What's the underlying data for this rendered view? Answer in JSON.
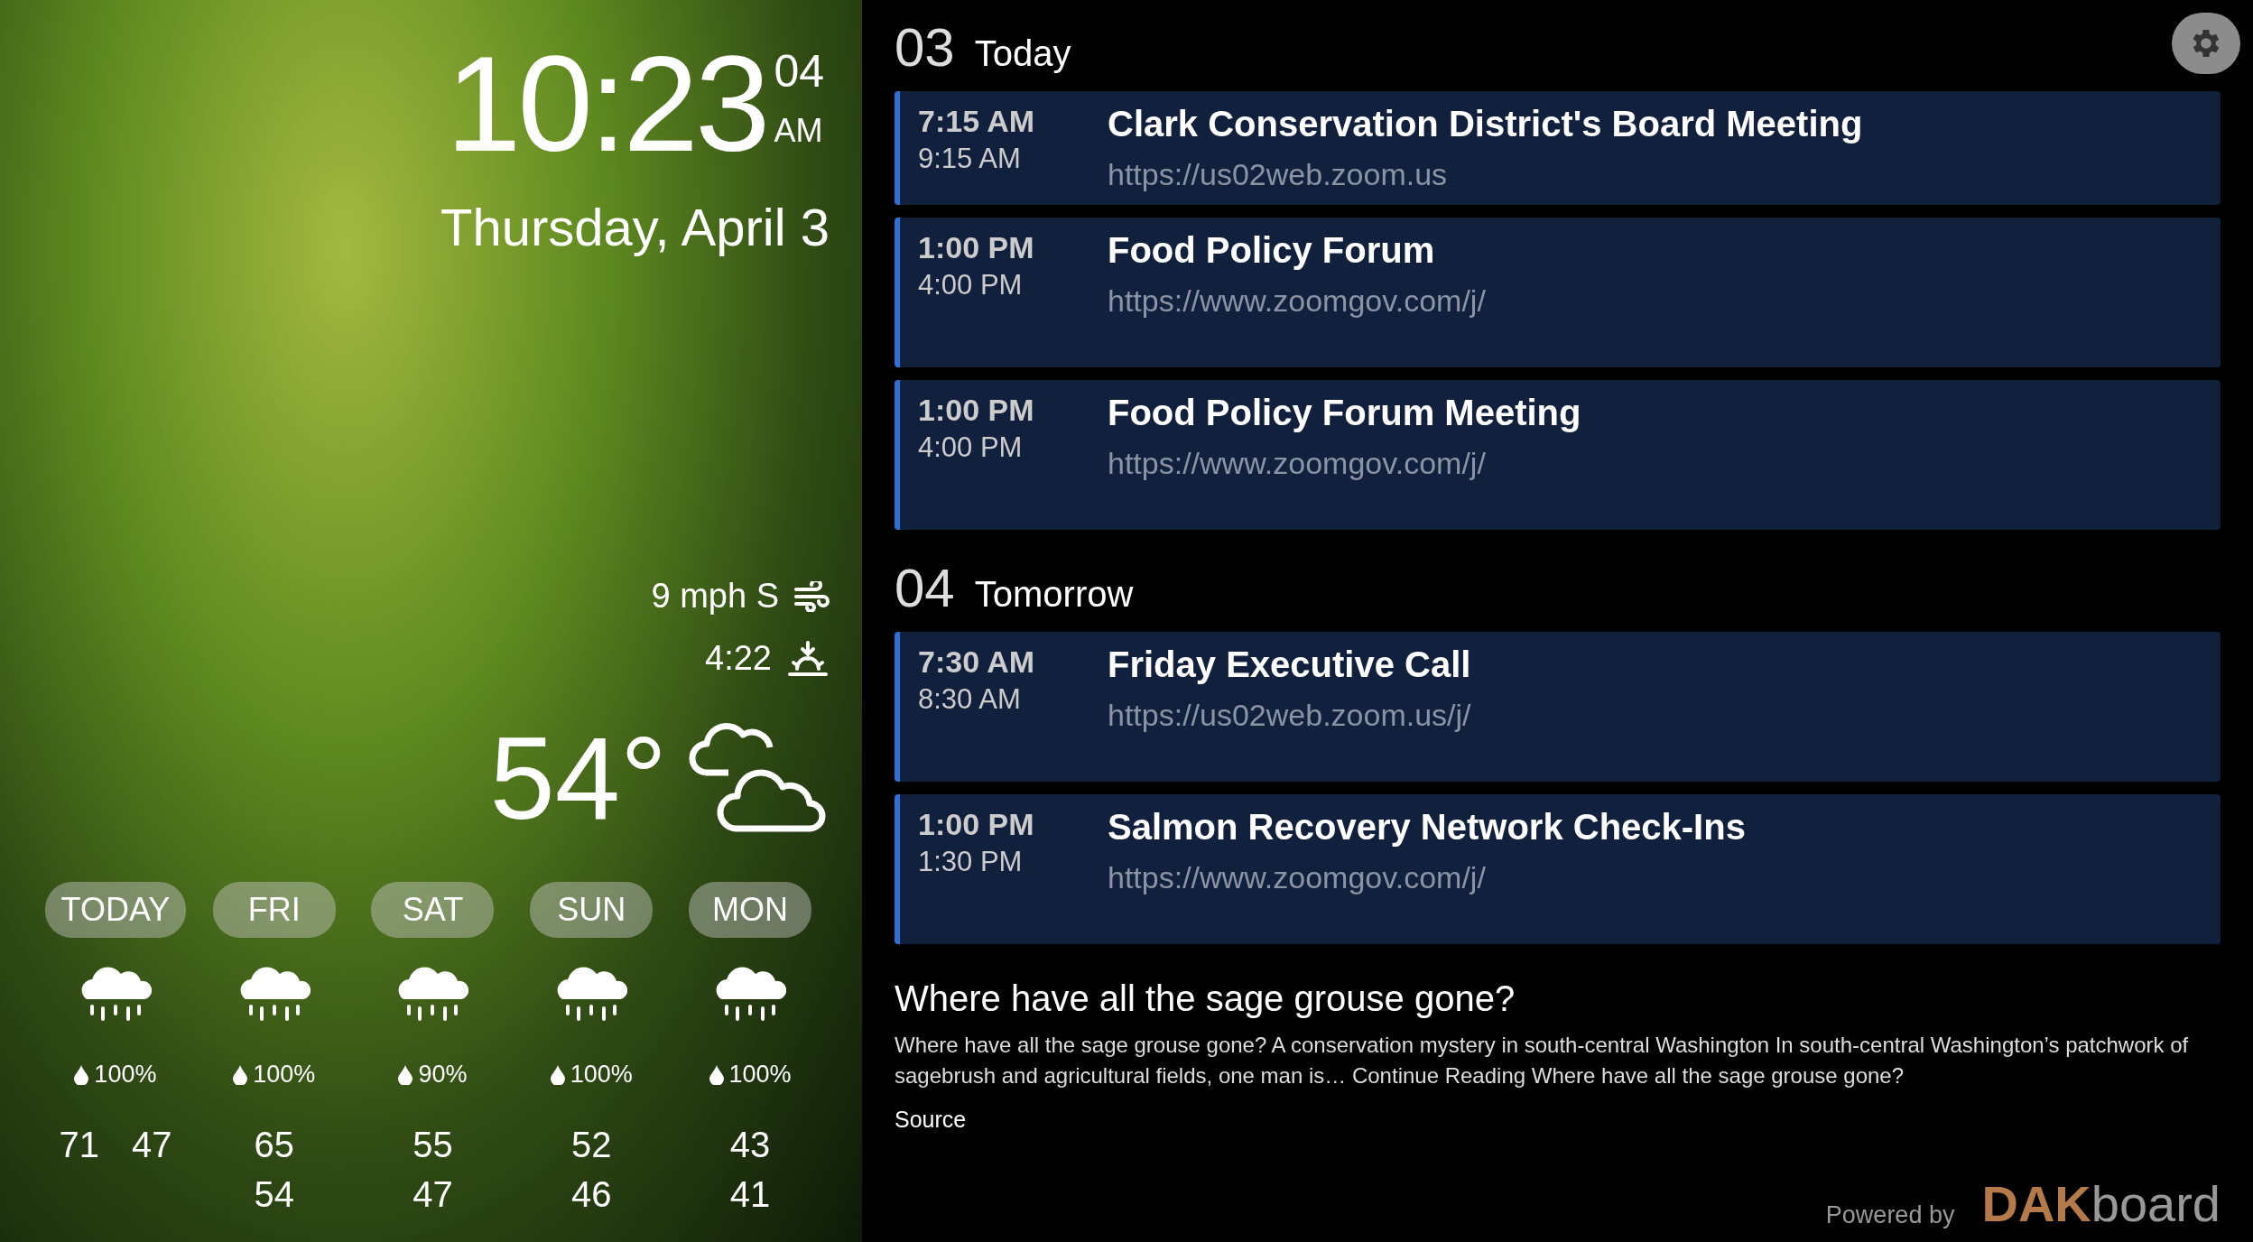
{
  "clock": {
    "time": "10:23",
    "seconds": "04",
    "meridiem": "AM",
    "date": "Thursday, April 3"
  },
  "conditions": {
    "wind": "9 mph S",
    "sunset": "4:22",
    "temperature": "54°"
  },
  "forecast": [
    {
      "day": "TODAY",
      "kind": "inline",
      "precip": "100%",
      "high": "71",
      "low": "47"
    },
    {
      "day": "FRI",
      "kind": "stacked",
      "precip": "100%",
      "high": "65",
      "low": "54"
    },
    {
      "day": "SAT",
      "kind": "stacked",
      "precip": "90%",
      "high": "55",
      "low": "47"
    },
    {
      "day": "SUN",
      "kind": "stacked",
      "precip": "100%",
      "high": "52",
      "low": "46"
    },
    {
      "day": "MON",
      "kind": "stacked",
      "precip": "100%",
      "high": "43",
      "low": "41"
    }
  ],
  "calendar": [
    {
      "date": "03",
      "label": "Today",
      "events": [
        {
          "start": "7:15 AM",
          "end": "9:15 AM",
          "title": "Clark Conservation District's Board Meeting",
          "link": "https://us02web.zoom.us"
        },
        {
          "start": "1:00 PM",
          "end": "4:00 PM",
          "title": "Food Policy Forum",
          "link": "https://www.zoomgov.com/j/"
        },
        {
          "start": "1:00 PM",
          "end": "4:00 PM",
          "title": "Food Policy Forum Meeting",
          "link": "https://www.zoomgov.com/j/"
        }
      ]
    },
    {
      "date": "04",
      "label": "Tomorrow",
      "events": [
        {
          "start": "7:30 AM",
          "end": "8:30 AM",
          "title": "Friday Executive Call",
          "link": "https://us02web.zoom.us/j/"
        },
        {
          "start": "1:00 PM",
          "end": "1:30 PM",
          "title": "Salmon Recovery Network Check-Ins",
          "link": "https://www.zoomgov.com/j/"
        }
      ]
    }
  ],
  "news": {
    "title": "Where have all the sage grouse gone?",
    "body": "Where have all the sage grouse gone? A conservation mystery in south-central Washington In south-central Washington’s patchwork of sagebrush and agricultural fields, one man is… Continue Reading Where have all the sage grouse gone?",
    "source": "Source"
  },
  "footer": {
    "powered": "Powered by",
    "logo_mark": "DAK",
    "logo_word": "board"
  }
}
